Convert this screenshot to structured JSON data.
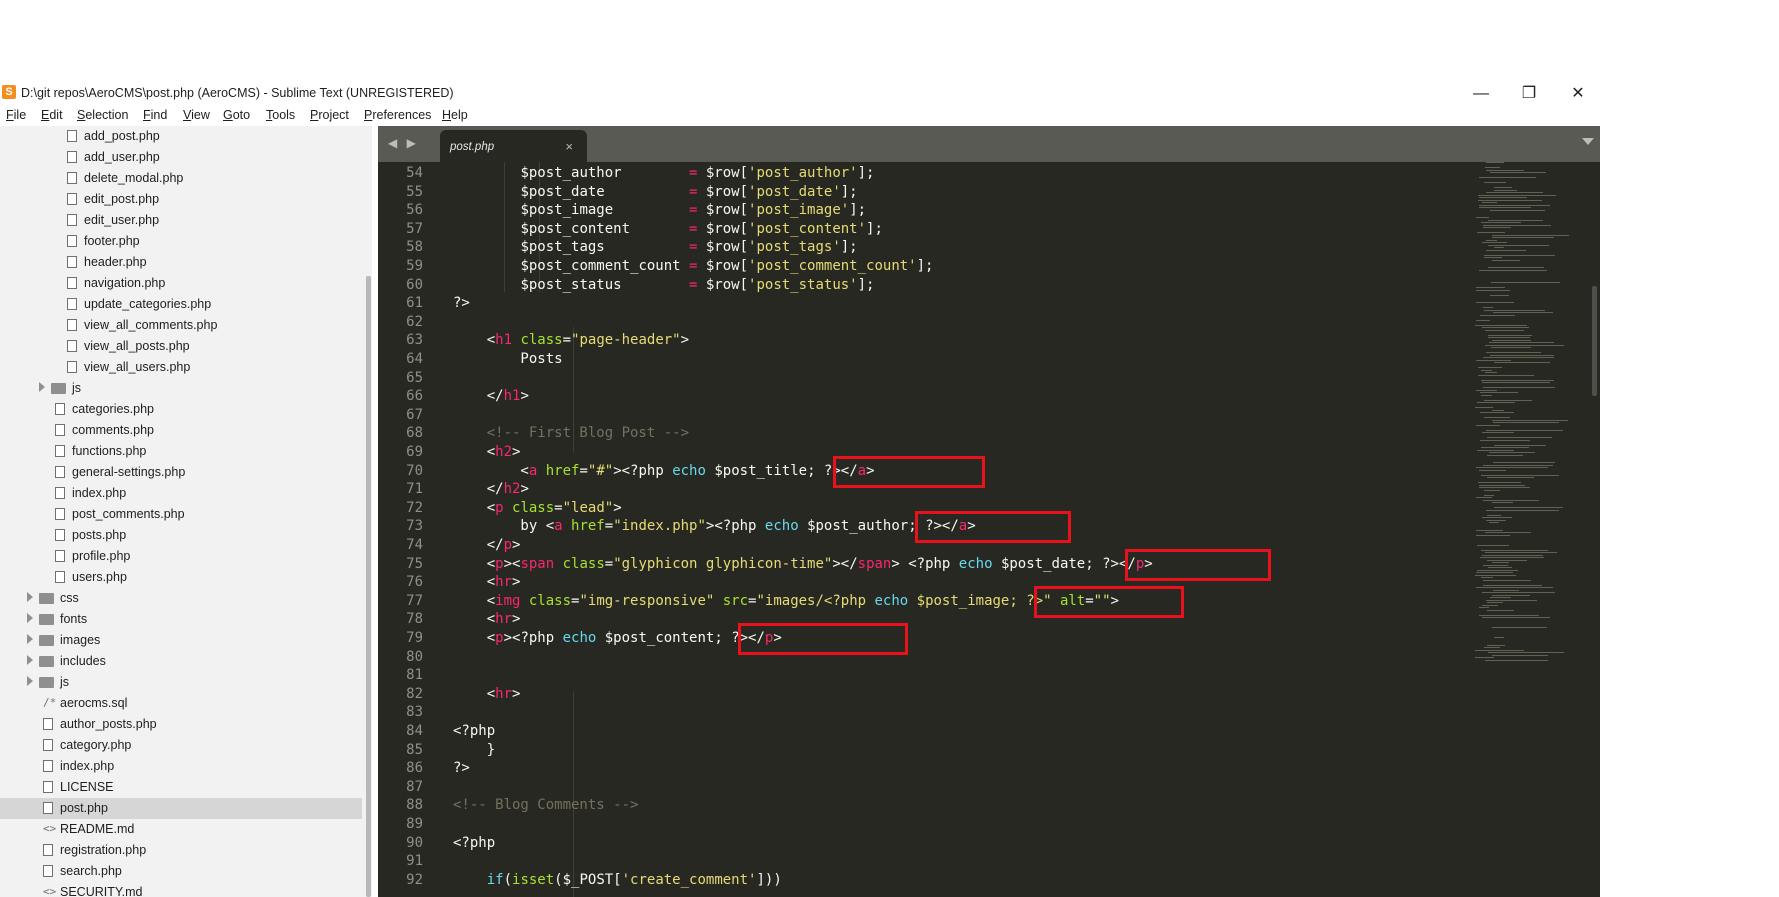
{
  "window": {
    "title": "D:\\git repos\\AeroCMS\\post.php (AeroCMS) - Sublime Text (UNREGISTERED)",
    "app_icon": "S",
    "controls": {
      "minimize": "—",
      "restore": "❐",
      "close": "✕"
    }
  },
  "menu": [
    "File",
    "Edit",
    "Selection",
    "Find",
    "View",
    "Goto",
    "Tools",
    "Project",
    "Preferences",
    "Help"
  ],
  "sidebar": {
    "items": [
      {
        "label": "add_post.php",
        "type": "file",
        "depth": 3
      },
      {
        "label": "add_user.php",
        "type": "file",
        "depth": 3
      },
      {
        "label": "delete_modal.php",
        "type": "file",
        "depth": 3
      },
      {
        "label": "edit_post.php",
        "type": "file",
        "depth": 3
      },
      {
        "label": "edit_user.php",
        "type": "file",
        "depth": 3
      },
      {
        "label": "footer.php",
        "type": "file",
        "depth": 3
      },
      {
        "label": "header.php",
        "type": "file",
        "depth": 3
      },
      {
        "label": "navigation.php",
        "type": "file",
        "depth": 3
      },
      {
        "label": "update_categories.php",
        "type": "file",
        "depth": 3
      },
      {
        "label": "view_all_comments.php",
        "type": "file",
        "depth": 3
      },
      {
        "label": "view_all_posts.php",
        "type": "file",
        "depth": 3
      },
      {
        "label": "view_all_users.php",
        "type": "file",
        "depth": 3
      },
      {
        "label": "js",
        "type": "folder",
        "depth": 2
      },
      {
        "label": "categories.php",
        "type": "file",
        "depth": 2
      },
      {
        "label": "comments.php",
        "type": "file",
        "depth": 2
      },
      {
        "label": "functions.php",
        "type": "file",
        "depth": 2
      },
      {
        "label": "general-settings.php",
        "type": "file",
        "depth": 2
      },
      {
        "label": "index.php",
        "type": "file",
        "depth": 2
      },
      {
        "label": "post_comments.php",
        "type": "file",
        "depth": 2
      },
      {
        "label": "posts.php",
        "type": "file",
        "depth": 2
      },
      {
        "label": "profile.php",
        "type": "file",
        "depth": 2
      },
      {
        "label": "users.php",
        "type": "file",
        "depth": 2
      },
      {
        "label": "css",
        "type": "folder",
        "depth": 1
      },
      {
        "label": "fonts",
        "type": "folder",
        "depth": 1
      },
      {
        "label": "images",
        "type": "folder",
        "depth": 1
      },
      {
        "label": "includes",
        "type": "folder",
        "depth": 1
      },
      {
        "label": "js",
        "type": "folder",
        "depth": 1
      },
      {
        "label": "aerocms.sql",
        "type": "sql",
        "depth": 1
      },
      {
        "label": "author_posts.php",
        "type": "file",
        "depth": 1
      },
      {
        "label": "category.php",
        "type": "file",
        "depth": 1
      },
      {
        "label": "index.php",
        "type": "file",
        "depth": 1
      },
      {
        "label": "LICENSE",
        "type": "file",
        "depth": 1
      },
      {
        "label": "post.php",
        "type": "file",
        "depth": 1,
        "selected": true
      },
      {
        "label": "README.md",
        "type": "md",
        "depth": 1
      },
      {
        "label": "registration.php",
        "type": "file",
        "depth": 1
      },
      {
        "label": "search.php",
        "type": "file",
        "depth": 1
      },
      {
        "label": "SECURITY.md",
        "type": "md",
        "depth": 1
      }
    ]
  },
  "tabs": [
    {
      "label": "post.php",
      "active": true,
      "close": "×"
    }
  ],
  "nav_arrows": "◀ ▶",
  "code": {
    "lines": [
      {
        "n": "54",
        "t": [
          [
            "        ",
            "plain"
          ],
          [
            "$post_author        ",
            "plain"
          ],
          [
            "= ",
            "op"
          ],
          [
            "$row[",
            "plain"
          ],
          [
            "'post_author'",
            "str"
          ],
          [
            "];",
            "plain"
          ]
        ]
      },
      {
        "n": "55",
        "t": [
          [
            "        ",
            "plain"
          ],
          [
            "$post_date          ",
            "plain"
          ],
          [
            "= ",
            "op"
          ],
          [
            "$row[",
            "plain"
          ],
          [
            "'post_date'",
            "str"
          ],
          [
            "];",
            "plain"
          ]
        ]
      },
      {
        "n": "56",
        "t": [
          [
            "        ",
            "plain"
          ],
          [
            "$post_image         ",
            "plain"
          ],
          [
            "= ",
            "op"
          ],
          [
            "$row[",
            "plain"
          ],
          [
            "'post_image'",
            "str"
          ],
          [
            "];",
            "plain"
          ]
        ]
      },
      {
        "n": "57",
        "t": [
          [
            "        ",
            "plain"
          ],
          [
            "$post_content       ",
            "plain"
          ],
          [
            "= ",
            "op"
          ],
          [
            "$row[",
            "plain"
          ],
          [
            "'post_content'",
            "str"
          ],
          [
            "];",
            "plain"
          ]
        ]
      },
      {
        "n": "58",
        "t": [
          [
            "        ",
            "plain"
          ],
          [
            "$post_tags          ",
            "plain"
          ],
          [
            "= ",
            "op"
          ],
          [
            "$row[",
            "plain"
          ],
          [
            "'post_tags'",
            "str"
          ],
          [
            "];",
            "plain"
          ]
        ]
      },
      {
        "n": "59",
        "t": [
          [
            "        ",
            "plain"
          ],
          [
            "$post_comment_count ",
            "plain"
          ],
          [
            "= ",
            "op"
          ],
          [
            "$row[",
            "plain"
          ],
          [
            "'post_comment_count'",
            "str"
          ],
          [
            "];",
            "plain"
          ]
        ]
      },
      {
        "n": "60",
        "t": [
          [
            "        ",
            "plain"
          ],
          [
            "$post_status        ",
            "plain"
          ],
          [
            "= ",
            "op"
          ],
          [
            "$row[",
            "plain"
          ],
          [
            "'post_status'",
            "str"
          ],
          [
            "];",
            "plain"
          ]
        ]
      },
      {
        "n": "61",
        "t": [
          [
            "?>",
            "plain"
          ]
        ]
      },
      {
        "n": "62",
        "t": []
      },
      {
        "n": "63",
        "t": [
          [
            "    <",
            "plain"
          ],
          [
            "h1",
            "tag"
          ],
          [
            " class",
            "attr"
          ],
          [
            "=",
            "plain"
          ],
          [
            "\"page-header\"",
            "str"
          ],
          [
            ">",
            "plain"
          ]
        ]
      },
      {
        "n": "64",
        "t": [
          [
            "        Posts",
            "plain"
          ]
        ]
      },
      {
        "n": "65",
        "t": []
      },
      {
        "n": "66",
        "t": [
          [
            "    </",
            "plain"
          ],
          [
            "h1",
            "tag"
          ],
          [
            ">",
            "plain"
          ]
        ]
      },
      {
        "n": "67",
        "t": []
      },
      {
        "n": "68",
        "t": [
          [
            "    <!-- First Blog Post -->",
            "cmt"
          ]
        ]
      },
      {
        "n": "69",
        "t": [
          [
            "    <",
            "plain"
          ],
          [
            "h2",
            "tag"
          ],
          [
            ">",
            "plain"
          ]
        ]
      },
      {
        "n": "70",
        "t": [
          [
            "        <",
            "plain"
          ],
          [
            "a",
            "tag"
          ],
          [
            " href",
            "attr"
          ],
          [
            "=",
            "plain"
          ],
          [
            "\"#\"",
            "str"
          ],
          [
            "><?php ",
            "plain"
          ],
          [
            "echo",
            "kw"
          ],
          [
            " $post_title; ?></",
            "plain"
          ],
          [
            "a",
            "tag"
          ],
          [
            ">",
            "plain"
          ]
        ]
      },
      {
        "n": "71",
        "t": [
          [
            "    </",
            "plain"
          ],
          [
            "h2",
            "tag"
          ],
          [
            ">",
            "plain"
          ]
        ]
      },
      {
        "n": "72",
        "t": [
          [
            "    <",
            "plain"
          ],
          [
            "p",
            "tag"
          ],
          [
            " class",
            "attr"
          ],
          [
            "=",
            "plain"
          ],
          [
            "\"lead\"",
            "str"
          ],
          [
            ">",
            "plain"
          ]
        ]
      },
      {
        "n": "73",
        "t": [
          [
            "        by <",
            "plain"
          ],
          [
            "a",
            "tag"
          ],
          [
            " href",
            "attr"
          ],
          [
            "=",
            "plain"
          ],
          [
            "\"index.php\"",
            "str"
          ],
          [
            "><?php ",
            "plain"
          ],
          [
            "echo",
            "kw"
          ],
          [
            " $post_author; ?></",
            "plain"
          ],
          [
            "a",
            "tag"
          ],
          [
            ">",
            "plain"
          ]
        ]
      },
      {
        "n": "74",
        "t": [
          [
            "    </",
            "plain"
          ],
          [
            "p",
            "tag"
          ],
          [
            ">",
            "plain"
          ]
        ]
      },
      {
        "n": "75",
        "t": [
          [
            "    <",
            "plain"
          ],
          [
            "p",
            "tag"
          ],
          [
            "><",
            "plain"
          ],
          [
            "span",
            "tag"
          ],
          [
            " class",
            "attr"
          ],
          [
            "=",
            "plain"
          ],
          [
            "\"glyphicon glyphicon-time\"",
            "str"
          ],
          [
            "></",
            "plain"
          ],
          [
            "span",
            "tag"
          ],
          [
            "> <?php ",
            "plain"
          ],
          [
            "echo",
            "kw"
          ],
          [
            " $post_date; ?></",
            "plain"
          ],
          [
            "p",
            "tag"
          ],
          [
            ">",
            "plain"
          ]
        ]
      },
      {
        "n": "76",
        "t": [
          [
            "    <",
            "plain"
          ],
          [
            "hr",
            "tag"
          ],
          [
            ">",
            "plain"
          ]
        ]
      },
      {
        "n": "77",
        "t": [
          [
            "    <",
            "plain"
          ],
          [
            "img",
            "tag"
          ],
          [
            " class",
            "attr"
          ],
          [
            "=",
            "plain"
          ],
          [
            "\"img-responsive\"",
            "str"
          ],
          [
            " src",
            "attr"
          ],
          [
            "=",
            "plain"
          ],
          [
            "\"images/<?php ",
            "str"
          ],
          [
            "echo",
            "kw"
          ],
          [
            " $post_image; ?>\"",
            "str"
          ],
          [
            " alt",
            "attr"
          ],
          [
            "=",
            "plain"
          ],
          [
            "\"\"",
            "str"
          ],
          [
            ">",
            "plain"
          ]
        ]
      },
      {
        "n": "78",
        "t": [
          [
            "    <",
            "plain"
          ],
          [
            "hr",
            "tag"
          ],
          [
            ">",
            "plain"
          ]
        ]
      },
      {
        "n": "79",
        "t": [
          [
            "    <",
            "plain"
          ],
          [
            "p",
            "tag"
          ],
          [
            "><?php ",
            "plain"
          ],
          [
            "echo",
            "kw"
          ],
          [
            " $post_content; ?></",
            "plain"
          ],
          [
            "p",
            "tag"
          ],
          [
            ">",
            "plain"
          ]
        ]
      },
      {
        "n": "80",
        "t": []
      },
      {
        "n": "81",
        "t": []
      },
      {
        "n": "82",
        "t": [
          [
            "    <",
            "plain"
          ],
          [
            "hr",
            "tag"
          ],
          [
            ">",
            "plain"
          ]
        ]
      },
      {
        "n": "83",
        "t": []
      },
      {
        "n": "84",
        "t": [
          [
            "<?php",
            "plain"
          ]
        ]
      },
      {
        "n": "85",
        "t": [
          [
            "    }",
            "plain"
          ]
        ]
      },
      {
        "n": "86",
        "t": [
          [
            "?>",
            "plain"
          ]
        ]
      },
      {
        "n": "87",
        "t": []
      },
      {
        "n": "88",
        "t": [
          [
            "<!-- Blog Comments -->",
            "cmt"
          ]
        ]
      },
      {
        "n": "89",
        "t": []
      },
      {
        "n": "90",
        "t": [
          [
            "<?php",
            "plain"
          ]
        ]
      },
      {
        "n": "91",
        "t": []
      },
      {
        "n": "92",
        "t": [
          [
            "    ",
            "plain"
          ],
          [
            "if",
            "kw"
          ],
          [
            "(",
            "plain"
          ],
          [
            "isset",
            "fn"
          ],
          [
            "($_POST[",
            "plain"
          ],
          [
            "'create_comment'",
            "str"
          ],
          [
            "]))",
            "plain"
          ]
        ]
      }
    ]
  },
  "colors": {
    "editor_bg": "#272822",
    "sidebar_bg": "#f2f2f2",
    "highlight_box": "#e8111c",
    "keyword": "#66d9ef",
    "string": "#e6db74",
    "tag": "#f92672",
    "attribute": "#a6e22e",
    "comment": "#75715e"
  }
}
